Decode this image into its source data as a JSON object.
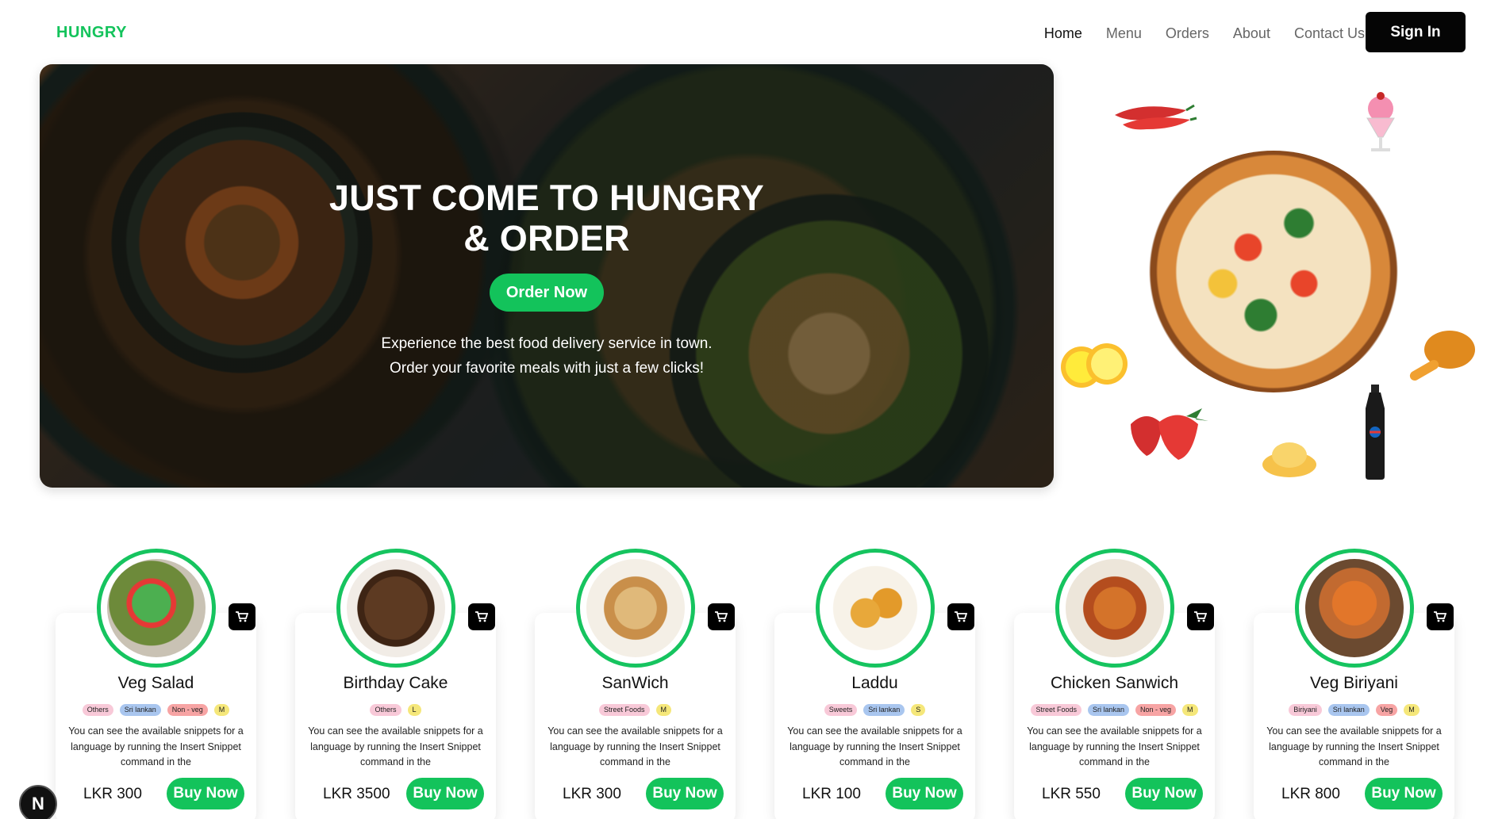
{
  "header": {
    "logo": "HUNGRY",
    "nav": [
      "Home",
      "Menu",
      "Orders",
      "About",
      "Contact Us"
    ],
    "sign_in": "Sign In"
  },
  "hero": {
    "title_line1": "JUST COME TO HUNGRY",
    "title_line2": "& ORDER",
    "order_button": "Order Now",
    "subtitle_line1": "Experience the best food delivery service in town.",
    "subtitle_line2": "Order your favorite meals with just a few clicks!"
  },
  "cards": [
    {
      "name": "Veg Salad",
      "tags": [
        "Others",
        "Sri lankan",
        "Non - veg",
        "M"
      ],
      "desc": "You can see the available snippets for a language by running the Insert Snippet command in the",
      "price": "LKR 300",
      "buy": "Buy Now"
    },
    {
      "name": "Birthday Cake",
      "tags": [
        "Others",
        "L"
      ],
      "desc": "You can see the available snippets for a language by running the Insert Snippet command in the",
      "price": "LKR 3500",
      "buy": "Buy Now"
    },
    {
      "name": "SanWich",
      "tags": [
        "Street Foods",
        "M"
      ],
      "desc": "You can see the available snippets for a language by running the Insert Snippet command in the",
      "price": "LKR 300",
      "buy": "Buy Now"
    },
    {
      "name": "Laddu",
      "tags": [
        "Sweets",
        "Sri lankan",
        "S"
      ],
      "desc": "You can see the available snippets for a language by running the Insert Snippet command in the",
      "price": "LKR 100",
      "buy": "Buy Now"
    },
    {
      "name": "Chicken Sanwich",
      "tags": [
        "Street Foods",
        "Sri lankan",
        "Non - veg",
        "M"
      ],
      "desc": "You can see the available snippets for a language by running the Insert Snippet command in the",
      "price": "LKR 550",
      "buy": "Buy Now"
    },
    {
      "name": "Veg Biriyani",
      "tags": [
        "Biriyani",
        "Sri lankan",
        "Veg",
        "M"
      ],
      "desc": "You can see the available snippets for a language by running the Insert Snippet command in the",
      "price": "LKR 800",
      "buy": "Buy Now"
    }
  ],
  "badge": "N",
  "colors": {
    "accent": "#13c35b",
    "dark": "#050505"
  }
}
